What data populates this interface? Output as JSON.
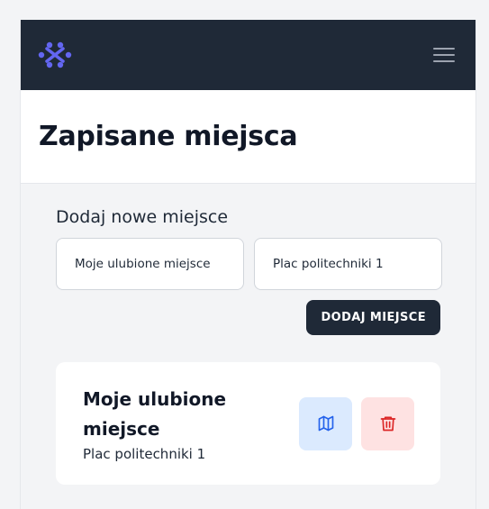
{
  "page": {
    "title": "Zapisane miejsca"
  },
  "form": {
    "heading": "Dodaj nowe miejsce",
    "name_input": {
      "value": "Moje ulubione miejsce",
      "placeholder": ""
    },
    "address_input": {
      "value": "Plac politechniki 1",
      "placeholder": ""
    },
    "add_button_label": "DODAJ MIEJSCE"
  },
  "places": [
    {
      "name": "Moje ulubione miejsce",
      "address": "Plac politechniki 1"
    }
  ],
  "icons": {
    "logo": "sparkle-logo-icon",
    "menu": "hamburger-menu-icon",
    "map": "map-icon",
    "delete": "trash-icon"
  },
  "colors": {
    "navbar": "#1f2937",
    "logo_accent": "#6366f1",
    "map_button_bg": "#dbeafe",
    "map_icon": "#2563eb",
    "delete_button_bg": "#fee2e2",
    "delete_icon": "#dc2626"
  }
}
